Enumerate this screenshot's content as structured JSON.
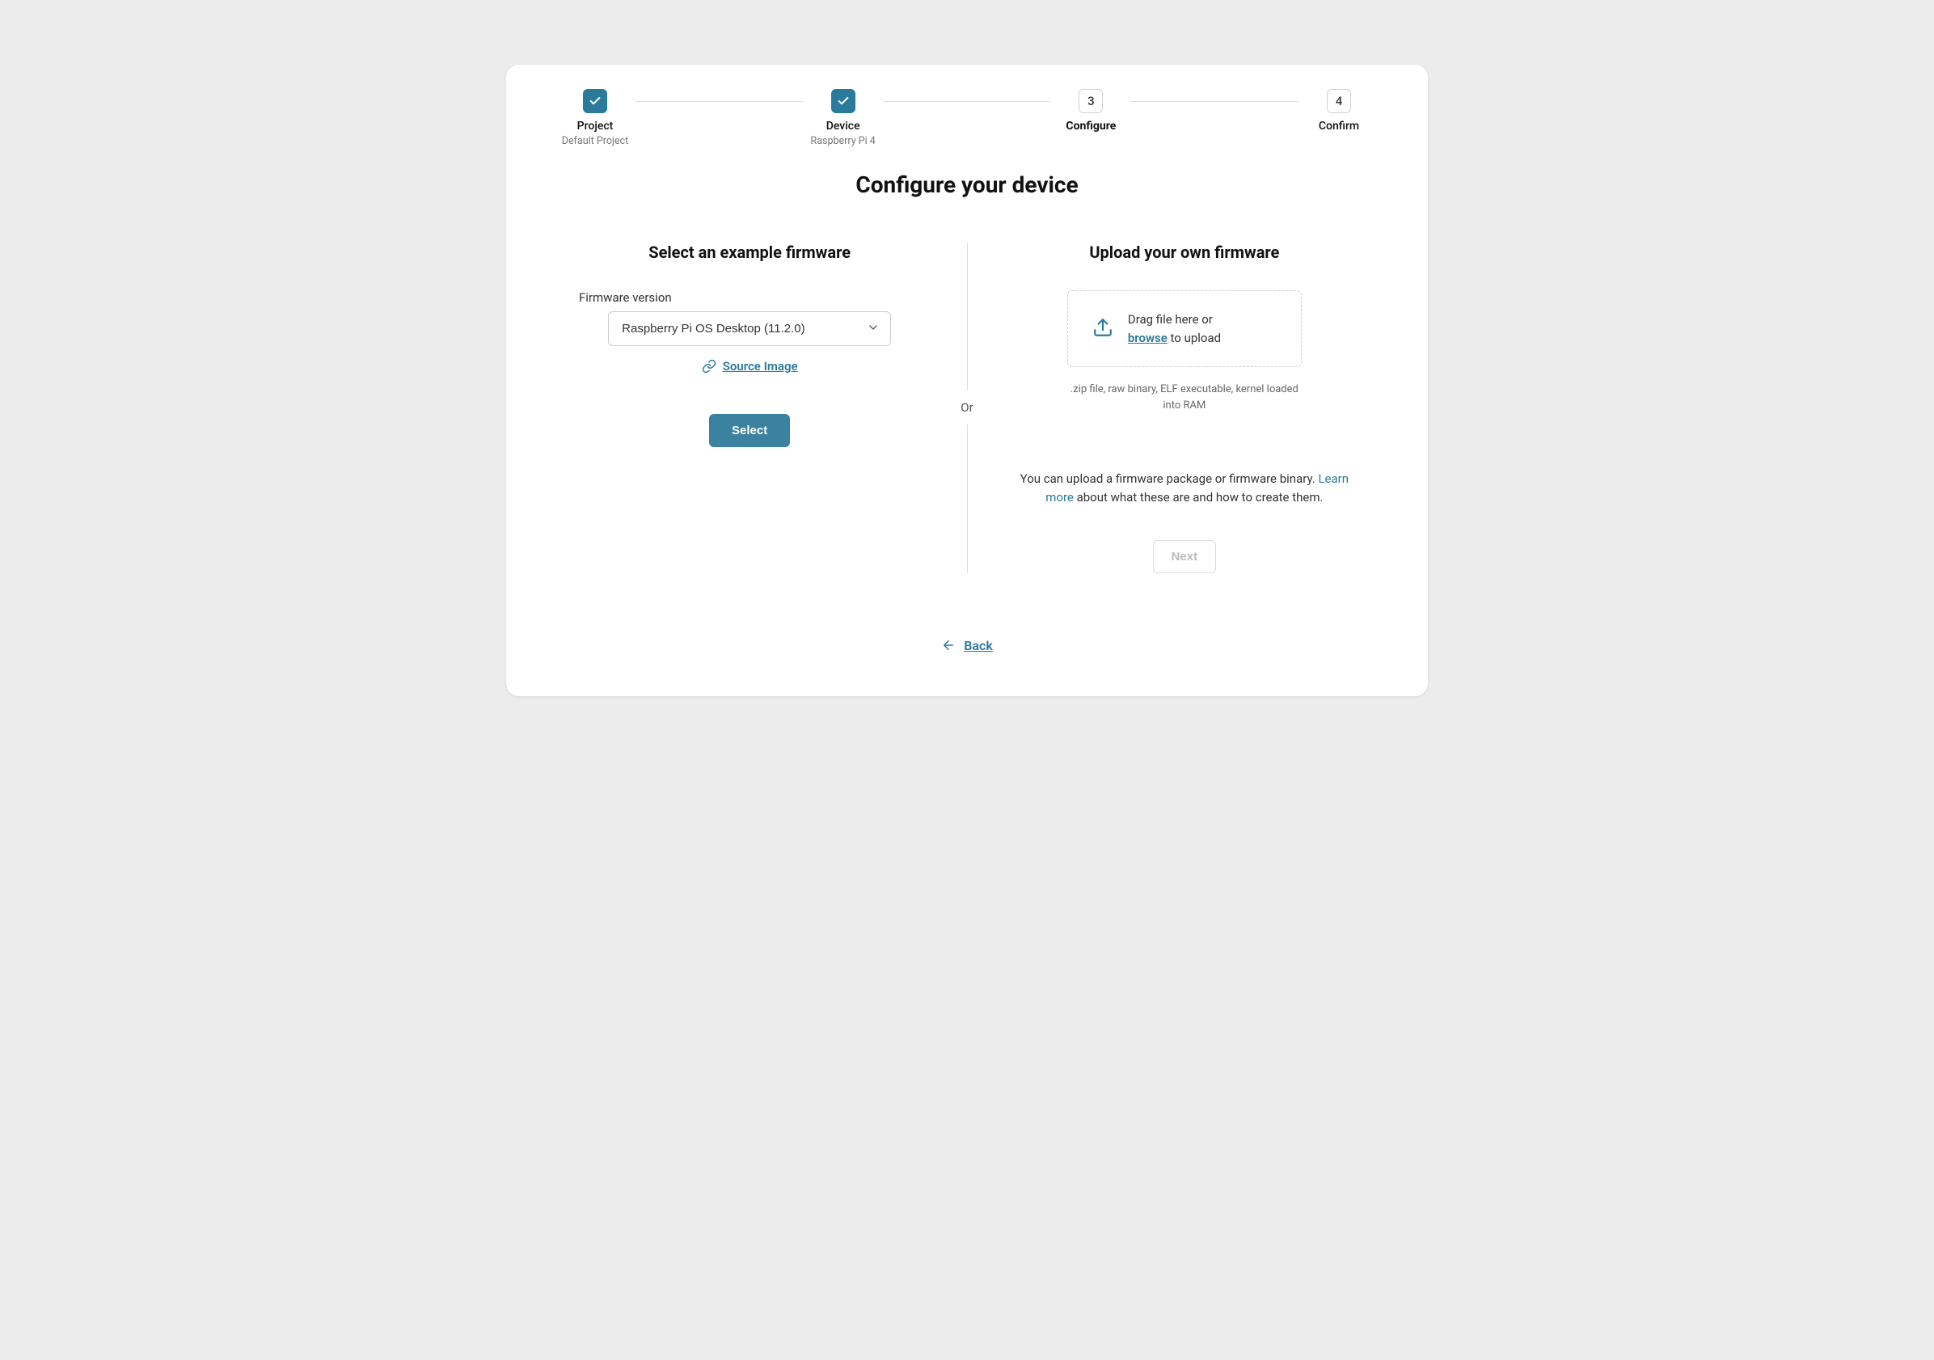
{
  "stepper": {
    "steps": [
      {
        "label": "Project",
        "sub": "Default Project"
      },
      {
        "label": "Device",
        "sub": "Raspberry Pi 4"
      },
      {
        "label": "Configure",
        "number": "3"
      },
      {
        "label": "Confirm",
        "number": "4"
      }
    ]
  },
  "heading": "Configure your device",
  "left": {
    "title": "Select an example firmware",
    "field_label": "Firmware version",
    "selected": "Raspberry Pi OS Desktop (11.2.0)",
    "source_link": "Source Image",
    "select_btn": "Select"
  },
  "divider_label": "Or",
  "right": {
    "title": "Upload your own firmware",
    "drop_line1": "Drag file here or",
    "drop_browse": "browse",
    "drop_line2_suffix": " to upload",
    "hint": ".zip file, raw binary, ELF executable, kernel loaded into RAM",
    "desc_prefix": "You can upload a firmware package or firmware binary. ",
    "desc_link": "Learn more",
    "desc_suffix": " about what these are and how to create them.",
    "next_btn": "Next"
  },
  "back_label": "Back"
}
